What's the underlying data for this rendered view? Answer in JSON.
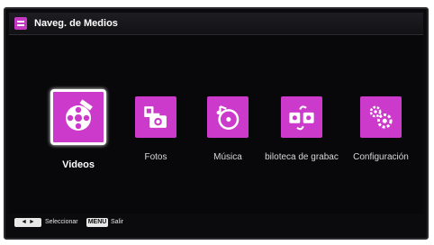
{
  "header": {
    "title": "Naveg. de Medios"
  },
  "items": [
    {
      "label": "Videos",
      "icon": "film-reel-icon"
    },
    {
      "label": "Fotos",
      "icon": "camera-photo-icon"
    },
    {
      "label": "Música",
      "icon": "music-disc-icon"
    },
    {
      "label": "biloteca de grabac",
      "icon": "recordings-icon"
    },
    {
      "label": "Configuración",
      "icon": "settings-gear-icon"
    }
  ],
  "selected_index": 0,
  "footer": {
    "select_key": "◄ ►",
    "select_label": "Seleccionar",
    "menu_key": "MENU",
    "menu_label": "Salir"
  },
  "colors": {
    "accent": "#cc3acb",
    "background": "#08080a"
  }
}
